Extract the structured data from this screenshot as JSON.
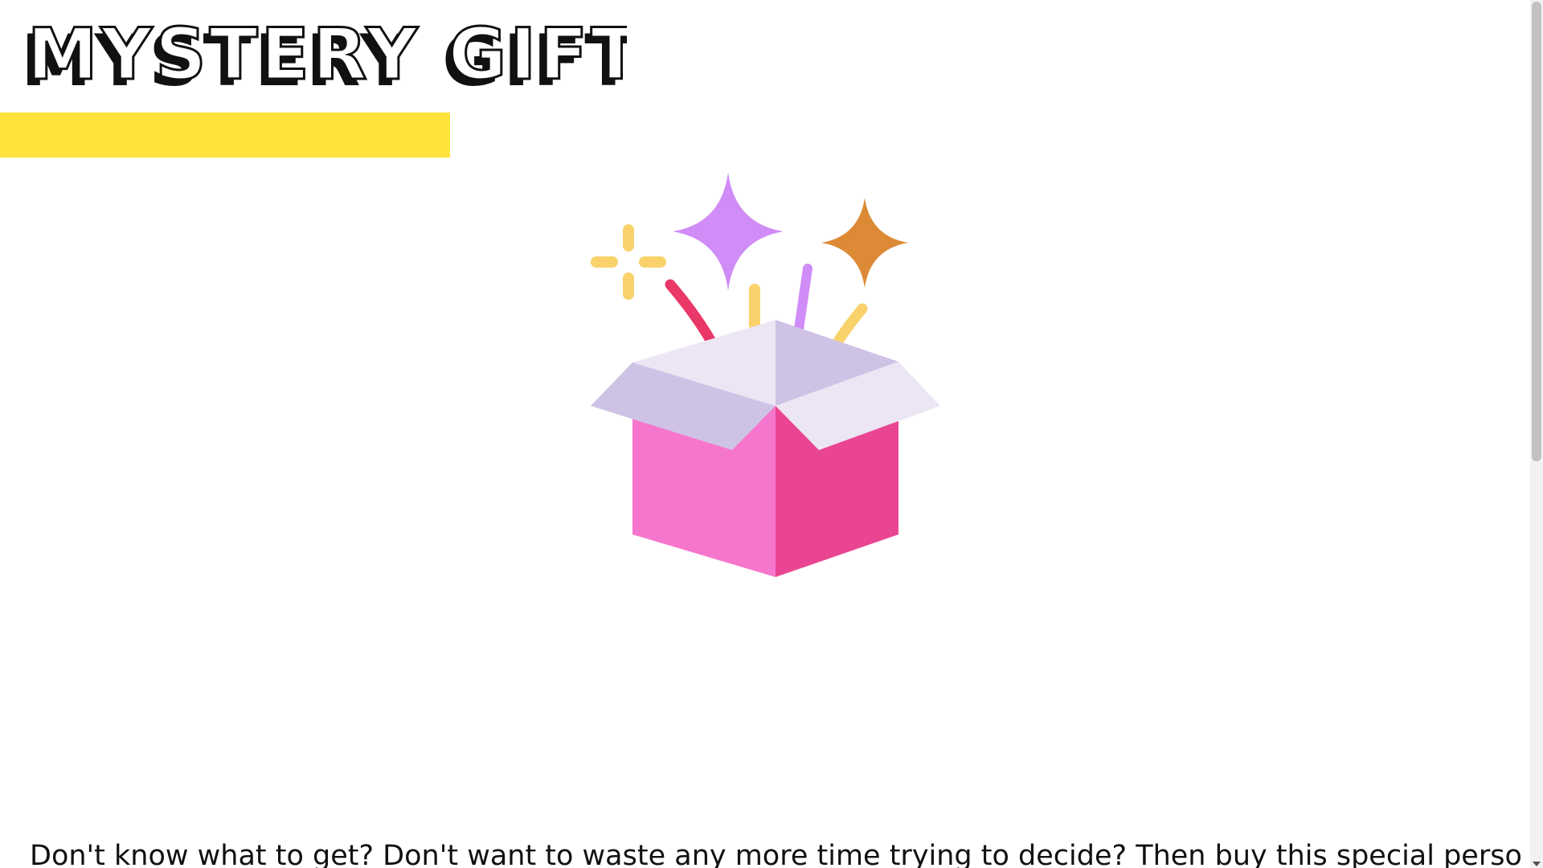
{
  "header": {
    "title": "MYSTERY GIFT"
  },
  "banner": {
    "color": "#FFE23A"
  },
  "hero": {
    "icon": "gift-box-sparkles-icon",
    "colors": {
      "purple_sparkle": "#D08CF7",
      "orange_sparkle": "#DC8A36",
      "yellow_sparkle": "#F9D26C",
      "red_streamer": "#E93768",
      "lid_light": "#ECE6F4",
      "lid_shade": "#CEC2E5",
      "box_left": "#F776CD",
      "box_right": "#EA4592"
    }
  },
  "main": {
    "description": "Don't know what to get? Don't want to waste any more time trying to decide? Then buy this special person"
  }
}
